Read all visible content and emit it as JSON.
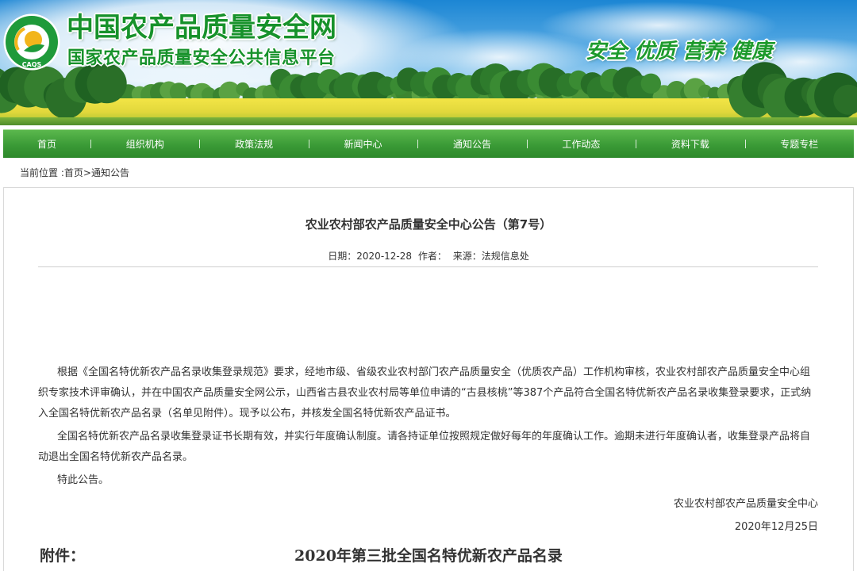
{
  "colors": {
    "brand_green": "#17922b",
    "nav_green": "#3a9a36",
    "text": "#333333",
    "border": "#d9d9d9"
  },
  "header": {
    "logo_text": "CAQS",
    "site_title": "中国农产品质量安全网",
    "site_subtitle": "国家农产品质量安全公共信息平台",
    "slogan": "安全 优质 营养 健康"
  },
  "nav": {
    "items": [
      {
        "label": "首页"
      },
      {
        "label": "组织机构"
      },
      {
        "label": "政策法规"
      },
      {
        "label": "新闻中心"
      },
      {
        "label": "通知公告"
      },
      {
        "label": "工作动态"
      },
      {
        "label": "资料下载"
      },
      {
        "label": "专题专栏"
      }
    ]
  },
  "breadcrumb": {
    "label": "当前位置 :",
    "home": "首页",
    "separator": ">",
    "current": "通知公告"
  },
  "article": {
    "title": "农业农村部农产品质量安全中心公告（第7号）",
    "meta": {
      "date_label": "日期：",
      "date": "2020-12-28",
      "author_label": "作者：",
      "source_label": "来源：",
      "source": "法规信息处"
    },
    "paragraphs": [
      "根据《全国名特优新农产品名录收集登录规范》要求，经地市级、省级农业农村部门农产品质量安全（优质农产品）工作机构审核，农业农村部农产品质量安全中心组织专家技术评审确认，并在中国农产品质量安全网公示，山西省古县农业农村局等单位申请的“古县核桃”等387个产品符合全国名特优新农产品名录收集登录要求，正式纳入全国名特优新农产品名录（名单见附件）。现予以公布，并核发全国名特优新农产品证书。",
      "全国名特优新农产品名录收集登录证书长期有效，并实行年度确认制度。请各持证单位按照规定做好每年的年度确认工作。逾期未进行年度确认者，收集登录产品将自动退出全国名特优新农产品名录。",
      "特此公告。"
    ],
    "signature": "农业农村部农产品质量安全中心",
    "sign_date": "2020年12月25日",
    "attachment_label": "附件：",
    "attachment_title": "2020年第三批全国名特优新农产品名录"
  }
}
